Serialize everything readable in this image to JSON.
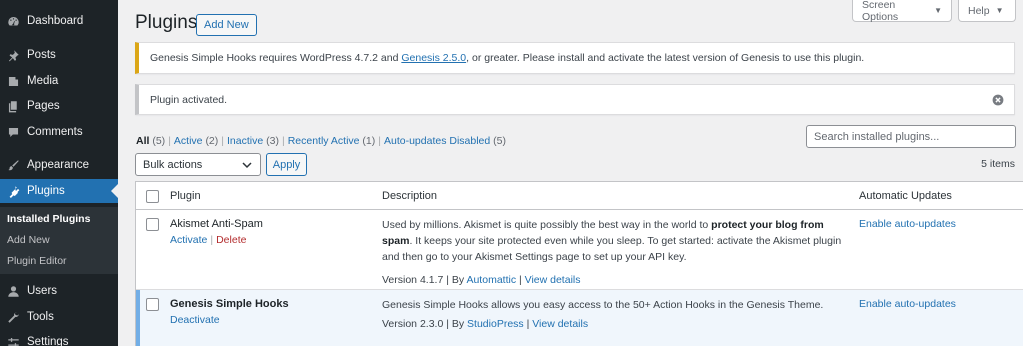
{
  "sidebar": {
    "menu": [
      {
        "label": "Dashboard",
        "icon": "dashboard-icon"
      },
      {
        "label": "Posts",
        "icon": "pin-icon"
      },
      {
        "label": "Media",
        "icon": "media-icon"
      },
      {
        "label": "Pages",
        "icon": "pages-icon"
      },
      {
        "label": "Comments",
        "icon": "comment-icon"
      },
      {
        "label": "Appearance",
        "icon": "brush-icon"
      },
      {
        "label": "Plugins",
        "icon": "plugin-icon"
      },
      {
        "label": "Users",
        "icon": "user-icon"
      },
      {
        "label": "Tools",
        "icon": "wrench-icon"
      },
      {
        "label": "Settings",
        "icon": "settings-icon"
      }
    ],
    "submenu": [
      "Installed Plugins",
      "Add New",
      "Plugin Editor"
    ]
  },
  "header": {
    "title": "Plugins",
    "add_new": "Add New",
    "screen_options": "Screen Options",
    "help": "Help"
  },
  "notices": {
    "warning_before": "Genesis Simple Hooks requires WordPress 4.7.2 and ",
    "warning_link": "Genesis 2.5.0",
    "warning_after": ", or greater. Please install and activate the latest version of Genesis to use this plugin.",
    "success": "Plugin activated."
  },
  "filters": [
    {
      "label": "All",
      "count": "(5)"
    },
    {
      "label": "Active",
      "count": "(2)"
    },
    {
      "label": "Inactive",
      "count": "(3)"
    },
    {
      "label": "Recently Active",
      "count": "(1)"
    },
    {
      "label": "Auto-updates Disabled",
      "count": "(5)"
    }
  ],
  "search": {
    "placeholder": "Search installed plugins..."
  },
  "bulk": {
    "selected": "Bulk actions",
    "apply": "Apply"
  },
  "items_count": "5 items",
  "table": {
    "columns": [
      "Plugin",
      "Description",
      "Automatic Updates"
    ],
    "rows": [
      {
        "name": "Akismet Anti-Spam",
        "action1": "Activate",
        "action2": "Delete",
        "desc_before": "Used by millions. Akismet is quite possibly the best way in the world to ",
        "desc_bold": "protect your blog from spam",
        "desc_after": ". It keeps your site protected even while you sleep. To get started: activate the Akismet plugin and then go to your Akismet Settings page to set up your API key.",
        "version": "Version 4.1.7",
        "by": "By",
        "author": "Automattic",
        "view": "View details",
        "auto": "Enable auto-updates"
      },
      {
        "name": "Genesis Simple Hooks",
        "action1": "Deactivate",
        "desc": "Genesis Simple Hooks allows you easy access to the 50+ Action Hooks in the Genesis Theme.",
        "version": "Version 2.3.0",
        "by": "By",
        "author": "StudioPress",
        "view": "View details",
        "auto": "Enable auto-updates"
      }
    ]
  },
  "colors": {
    "sidebar_bg": "#1d2327",
    "accent": "#2271b1",
    "warning_border": "#dba617",
    "active_row_border": "#72aee6"
  }
}
